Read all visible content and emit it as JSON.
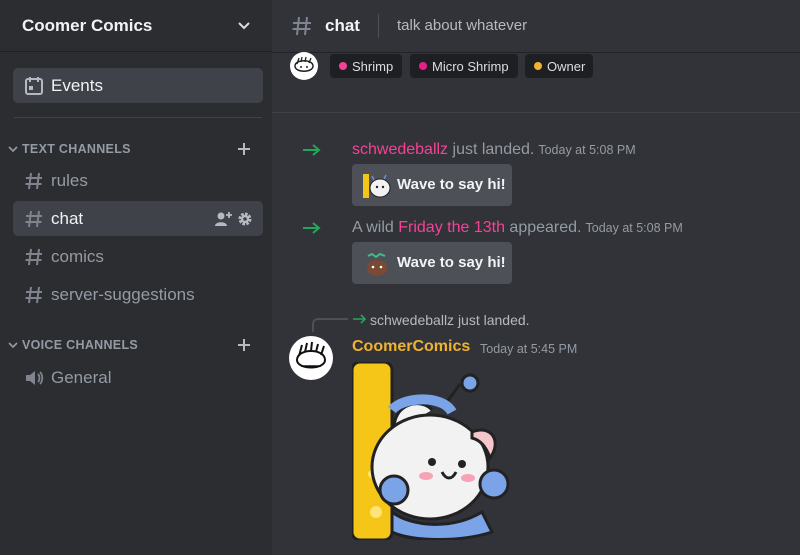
{
  "server": {
    "name": "Coomer Comics"
  },
  "sidebar": {
    "events_label": "Events",
    "text_category": "TEXT CHANNELS",
    "voice_category": "VOICE CHANNELS",
    "text_channels": [
      {
        "label": "rules"
      },
      {
        "label": "chat"
      },
      {
        "label": "comics"
      },
      {
        "label": "server-suggestions"
      }
    ],
    "voice_channels": [
      {
        "label": "General"
      }
    ]
  },
  "header": {
    "channel": "chat",
    "topic": "talk about whatever"
  },
  "roles": [
    {
      "label": "Shrimp",
      "color": "#f54296"
    },
    {
      "label": "Micro Shrimp",
      "color": "#e91e8c"
    },
    {
      "label": "Owner",
      "color": "#f0b232"
    }
  ],
  "messages": [
    {
      "user": "schwedeballz",
      "text": " just landed.",
      "ts": "Today at 5:08 PM",
      "wave": "Wave to say hi!"
    },
    {
      "prefix": "A wild ",
      "user": "Friday the 13th",
      "text": " appeared.",
      "ts": "Today at 5:08 PM",
      "wave": "Wave to say hi!"
    }
  ],
  "reply": {
    "text": "schwedeballz just landed."
  },
  "post": {
    "author": "CoomerComics",
    "ts": "Today at 5:45 PM"
  },
  "colors": {
    "accent_green": "#23a55a",
    "pink_user": "#f54296",
    "gold_user": "#f0b232"
  }
}
